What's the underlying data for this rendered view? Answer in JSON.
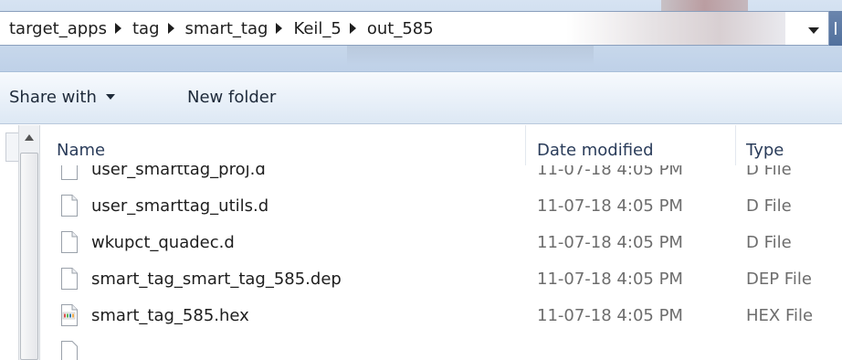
{
  "address_bar": {
    "crumbs": [
      "target_apps",
      "tag",
      "smart_tag",
      "Keil_5",
      "out_585"
    ]
  },
  "toolbar": {
    "share_with": "Share with",
    "new_folder": "New folder"
  },
  "columns": {
    "name": "Name",
    "date_modified": "Date modified",
    "type": "Type"
  },
  "files": [
    {
      "name": "user_smarttag_proj.d",
      "date": "11-07-18 4:05 PM",
      "type": "D File",
      "icon": "blank-file-icon"
    },
    {
      "name": "user_smarttag_utils.d",
      "date": "11-07-18 4:05 PM",
      "type": "D File",
      "icon": "blank-file-icon"
    },
    {
      "name": "wkupct_quadec.d",
      "date": "11-07-18 4:05 PM",
      "type": "D File",
      "icon": "blank-file-icon"
    },
    {
      "name": "smart_tag_smart_tag_585.dep",
      "date": "11-07-18 4:05 PM",
      "type": "DEP File",
      "icon": "blank-file-icon"
    },
    {
      "name": "smart_tag_585.hex",
      "date": "11-07-18 4:05 PM",
      "type": "HEX File",
      "icon": "hex-file-icon"
    }
  ]
}
